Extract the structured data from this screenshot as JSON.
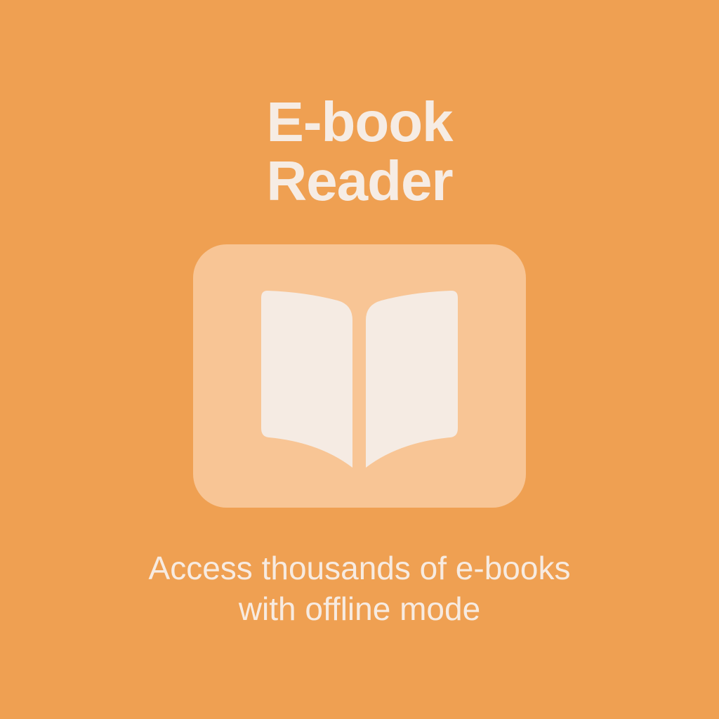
{
  "app": {
    "title_line1": "E-book",
    "title_line2": "Reader",
    "icon": "open-book-icon",
    "tagline_line1": "Access thousands of e-books",
    "tagline_line2": "with offline mode"
  },
  "colors": {
    "background": "#efa052",
    "icon_tile": "#f8c595",
    "book_pages": "#f5ebe3",
    "text": "#f6ece4"
  }
}
